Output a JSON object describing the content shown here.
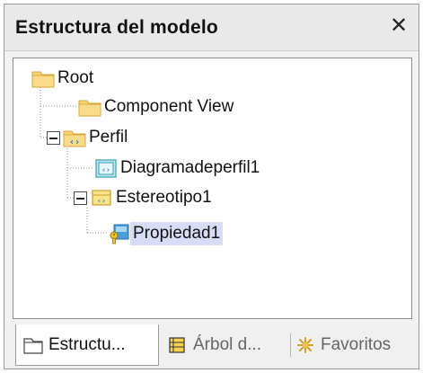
{
  "panel": {
    "title": "Estructura del modelo",
    "close_label": "✕"
  },
  "tree": {
    "nodes": [
      {
        "label": "Root",
        "icon": "folder-icon"
      },
      {
        "label": "Component View",
        "icon": "folder-icon"
      },
      {
        "label": "Perfil",
        "icon": "profile-package-icon",
        "expanded": true
      },
      {
        "label": "Diagramadeperfil1",
        "icon": "profile-diagram-icon"
      },
      {
        "label": "Estereotipo1",
        "icon": "stereotype-icon",
        "expanded": true
      },
      {
        "label": "Propiedad1",
        "icon": "property-key-icon",
        "selected": true
      }
    ]
  },
  "tabs": [
    {
      "label": "Estructu...",
      "icon": "folder-outline-icon",
      "active": true
    },
    {
      "label": "Árbol d...",
      "icon": "diagram-tree-icon",
      "active": false
    },
    {
      "label": "Favoritos",
      "icon": "favorites-star-icon",
      "active": false
    }
  ],
  "colors": {
    "selection": "#d8dcf7",
    "folder": "#f5d27a",
    "accent_blue": "#2f8fd1"
  }
}
